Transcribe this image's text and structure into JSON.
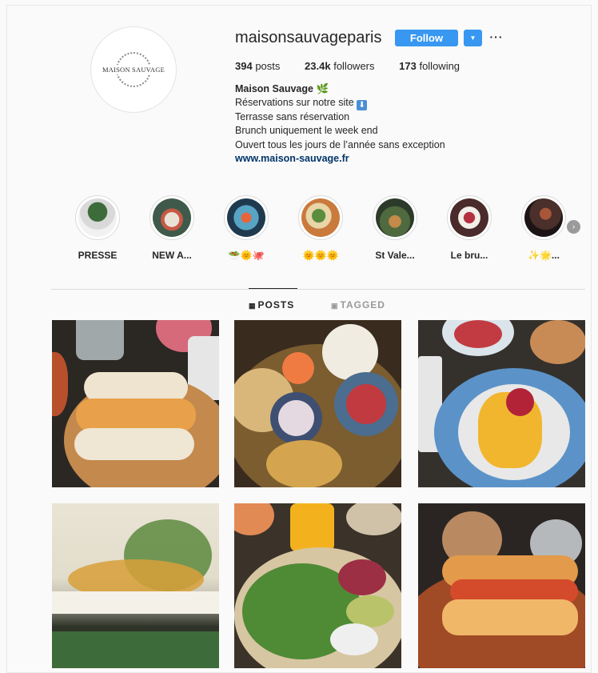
{
  "profile": {
    "username": "maisonsauvageparis",
    "avatar_text": "MAISON SAUVAGE",
    "follow_label": "Follow",
    "dropdown_icon": "caret-down-icon",
    "more_label": "···",
    "stats": {
      "posts_count": "394",
      "posts_label": "posts",
      "followers_count": "23.4k",
      "followers_label": "followers",
      "following_count": "173",
      "following_label": "following"
    },
    "bio": {
      "name": "Maison Sauvage",
      "name_emoji": "🌿",
      "line1": "Réservations sur notre site",
      "line1_icon": "⬇",
      "line2": "Terrasse sans réservation",
      "line3": "Brunch uniquement le week end",
      "line4": "Ouvert tous les jours de l’année sans exception",
      "link": "www.maison-sauvage.fr"
    }
  },
  "highlights": [
    {
      "label": "PRESSE"
    },
    {
      "label": "NEW A..."
    },
    {
      "label": "🥗🌞🐙"
    },
    {
      "label": "🌞🌞🌞"
    },
    {
      "label": "St Vale..."
    },
    {
      "label": "Le bru..."
    },
    {
      "label": "✨🌟..."
    }
  ],
  "tabs": {
    "posts_label": "POSTS",
    "tagged_label": "TAGGED"
  },
  "colors": {
    "accent": "#3897f0",
    "link": "#003569"
  }
}
